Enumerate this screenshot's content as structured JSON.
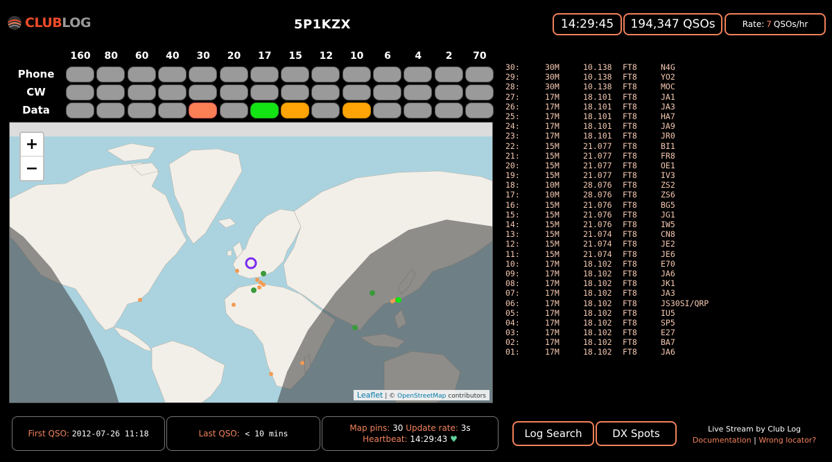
{
  "header": {
    "logo_club": "CLUB",
    "logo_log": "LOG",
    "callsign": "5P1KZX",
    "clock": "14:29:45",
    "qso_count": "194,347 QSOs",
    "rate_prefix": "Rate:",
    "rate_value": "7",
    "rate_suffix": "QSOs/hr"
  },
  "bands": [
    "160",
    "80",
    "60",
    "40",
    "30",
    "20",
    "17",
    "15",
    "12",
    "10",
    "6",
    "4",
    "2",
    "70"
  ],
  "modes": [
    {
      "label": "Phone",
      "cells": [
        "grey",
        "grey",
        "grey",
        "grey",
        "grey",
        "grey",
        "grey",
        "grey",
        "grey",
        "grey",
        "grey",
        "grey",
        "grey",
        "grey"
      ]
    },
    {
      "label": "CW",
      "cells": [
        "grey",
        "grey",
        "grey",
        "grey",
        "grey",
        "grey",
        "grey",
        "grey",
        "grey",
        "grey",
        "grey",
        "grey",
        "grey",
        "grey"
      ]
    },
    {
      "label": "Data",
      "cells": [
        "grey",
        "grey",
        "grey",
        "grey",
        "red",
        "grey",
        "green",
        "orange",
        "grey",
        "orange",
        "grey",
        "grey",
        "grey",
        "grey"
      ]
    }
  ],
  "map": {
    "zoom_in": "+",
    "zoom_out": "−",
    "attribution_leaflet": "Leaflet",
    "attribution_sep": "| ©",
    "attribution_osm": "OpenStreetMap",
    "attribution_tail": "contributors",
    "colors": {
      "sea": "#aad3df",
      "land": "#f2efe9",
      "night": "#555555",
      "station_ring": "#7a2cf0",
      "pin_recent": "#f39a52",
      "pin_green": "#3a9a3a"
    }
  },
  "log": [
    [
      "30:",
      "30M",
      "10.138",
      "FT8",
      "N4G"
    ],
    [
      "29:",
      "30M",
      "10.138",
      "FT8",
      "YO2"
    ],
    [
      "28:",
      "30M",
      "10.138",
      "FT8",
      "MOC"
    ],
    [
      "27:",
      "17M",
      "18.101",
      "FT8",
      "JA1"
    ],
    [
      "26:",
      "17M",
      "18.101",
      "FT8",
      "JA3"
    ],
    [
      "25:",
      "17M",
      "18.101",
      "FT8",
      "HA7"
    ],
    [
      "24:",
      "17M",
      "18.101",
      "FT8",
      "JA9"
    ],
    [
      "23:",
      "17M",
      "18.101",
      "FT8",
      "JR0"
    ],
    [
      "22:",
      "15M",
      "21.077",
      "FT8",
      "BI1"
    ],
    [
      "21:",
      "15M",
      "21.077",
      "FT8",
      "FR8"
    ],
    [
      "20:",
      "15M",
      "21.077",
      "FT8",
      "OE1"
    ],
    [
      "19:",
      "15M",
      "21.077",
      "FT8",
      "IV3"
    ],
    [
      "18:",
      "10M",
      "28.076",
      "FT8",
      "ZS2"
    ],
    [
      "17:",
      "10M",
      "28.076",
      "FT8",
      "ZS6"
    ],
    [
      "16:",
      "15M",
      "21.076",
      "FT8",
      "BG5"
    ],
    [
      "15:",
      "15M",
      "21.076",
      "FT8",
      "JG1"
    ],
    [
      "14:",
      "15M",
      "21.076",
      "FT8",
      "IW5"
    ],
    [
      "13:",
      "15M",
      "21.074",
      "FT8",
      "CN8"
    ],
    [
      "12:",
      "15M",
      "21.074",
      "FT8",
      "JE2"
    ],
    [
      "11:",
      "15M",
      "21.074",
      "FT8",
      "JE6"
    ],
    [
      "10:",
      "17M",
      "18.102",
      "FT8",
      "E70"
    ],
    [
      "09:",
      "17M",
      "18.102",
      "FT8",
      "JA6"
    ],
    [
      "08:",
      "17M",
      "18.102",
      "FT8",
      "JK1"
    ],
    [
      "07:",
      "17M",
      "18.102",
      "FT8",
      "JA3"
    ],
    [
      "06:",
      "17M",
      "18.102",
      "FT8",
      "JS30SI/QRP"
    ],
    [
      "05:",
      "17M",
      "18.102",
      "FT8",
      "IU5"
    ],
    [
      "04:",
      "17M",
      "18.102",
      "FT8",
      "SP5"
    ],
    [
      "03:",
      "17M",
      "18.102",
      "FT8",
      "E27"
    ],
    [
      "02:",
      "17M",
      "18.102",
      "FT8",
      "BA7"
    ],
    [
      "01:",
      "17M",
      "18.102",
      "FT8",
      "JA6"
    ]
  ],
  "footer": {
    "first_qso_label": "First QSO:",
    "first_qso_value": "2012-07-26 11:18",
    "last_qso_label": "Last QSO:",
    "last_qso_value": "< 10 mins",
    "map_pins_label": "Map pins:",
    "map_pins_value": "30",
    "update_rate_label": "Update rate:",
    "update_rate_value": "3s",
    "heartbeat_label": "Heartbeat:",
    "heartbeat_value": "14:29:43",
    "heartbeat_icon": "♥",
    "log_search": "Log Search",
    "dx_spots": "DX Spots",
    "credit": "Live Stream by Club Log",
    "documentation": "Documentation",
    "credit_sep": "|",
    "wrong_locator": "Wrong locator?"
  }
}
